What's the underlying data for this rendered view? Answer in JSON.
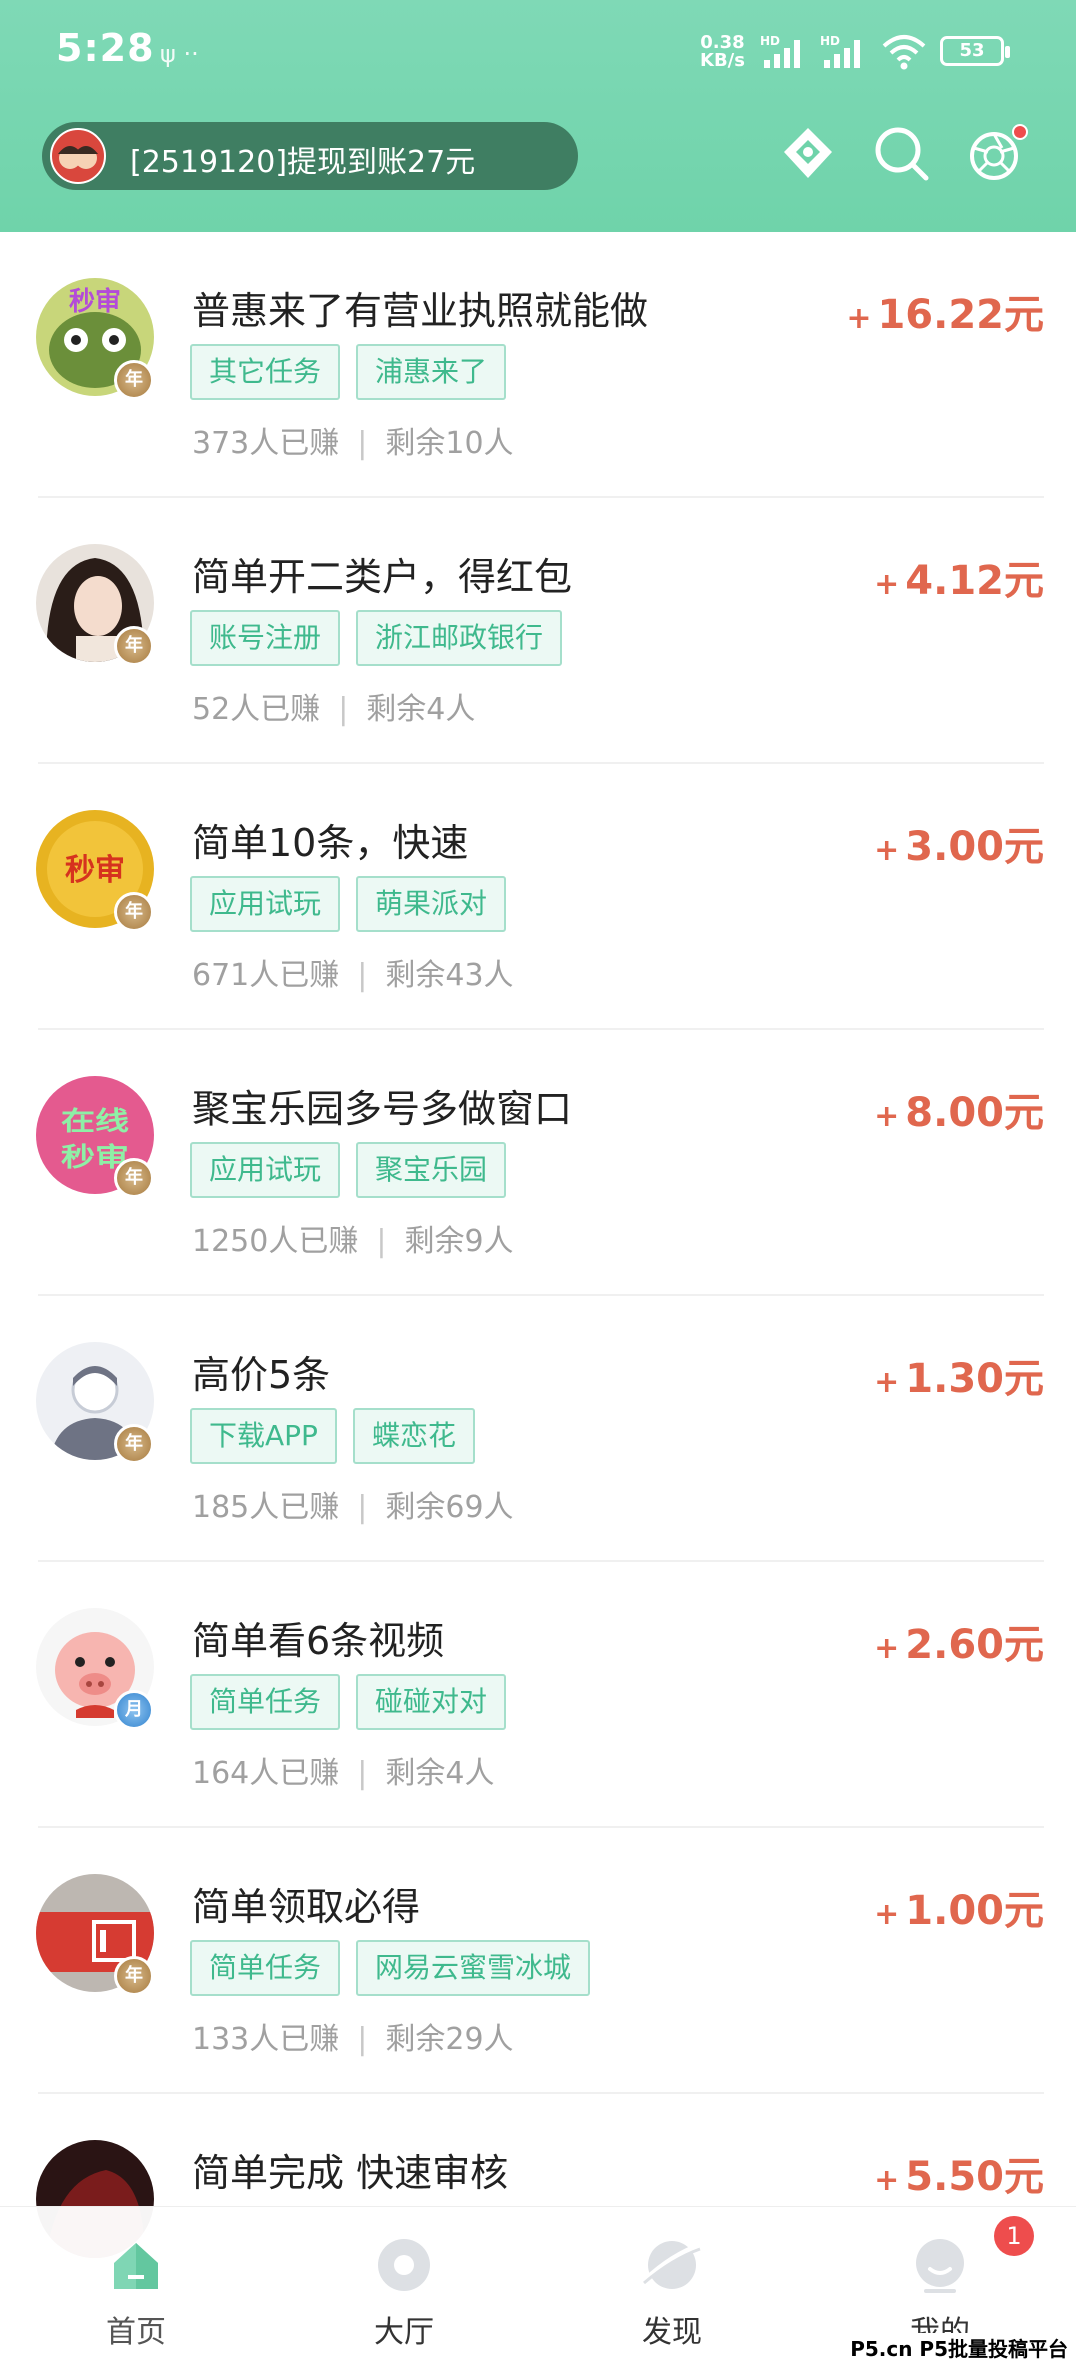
{
  "status_bar": {
    "time": "5:28",
    "extra_icons": "ψ  ··",
    "net_speed_value": "0.38",
    "net_speed_unit": "KB/s",
    "signal_label_1": "HD",
    "signal_label_2": "HD",
    "battery": "53"
  },
  "header": {
    "notice_text": "[2519120]提现到账27元",
    "icons": [
      "hall-logo-icon",
      "search-icon",
      "camera-shutter-icon"
    ]
  },
  "tasks": [
    {
      "title": "普惠来了有营业执照就能做",
      "reward": "16.22元",
      "tags": [
        "其它任务",
        "浦惠来了"
      ],
      "earned": "373人已赚",
      "remaining": "剩余10人",
      "badge": "年",
      "avatar_text": "秒审"
    },
    {
      "title": "简单开二类户，得红包",
      "reward": "4.12元",
      "tags": [
        "账号注册",
        "浙江邮政银行"
      ],
      "earned": "52人已赚",
      "remaining": "剩余4人",
      "badge": "年",
      "avatar_text": ""
    },
    {
      "title": "简单10条，快速",
      "reward": "3.00元",
      "tags": [
        "应用试玩",
        "萌果派对"
      ],
      "earned": "671人已赚",
      "remaining": "剩余43人",
      "badge": "年",
      "avatar_text": "秒审"
    },
    {
      "title": "聚宝乐园多号多做窗口",
      "reward": "8.00元",
      "tags": [
        "应用试玩",
        "聚宝乐园"
      ],
      "earned": "1250人已赚",
      "remaining": "剩余9人",
      "badge": "年",
      "avatar_text": "在线秒审"
    },
    {
      "title": "高价5条",
      "reward": "1.30元",
      "tags": [
        "下载APP",
        "蝶恋花"
      ],
      "earned": "185人已赚",
      "remaining": "剩余69人",
      "badge": "年",
      "avatar_text": ""
    },
    {
      "title": "简单看6条视频",
      "reward": "2.60元",
      "tags": [
        "简单任务",
        "碰碰对对"
      ],
      "earned": "164人已赚",
      "remaining": "剩余4人",
      "badge": "月",
      "avatar_text": ""
    },
    {
      "title": "简单领取必得",
      "reward": "1.00元",
      "tags": [
        "简单任务",
        "网易云蜜雪冰城"
      ],
      "earned": "133人已赚",
      "remaining": "剩余29人",
      "badge": "年",
      "avatar_text": ""
    },
    {
      "title": "简单完成 快速审核",
      "reward": "5.50元",
      "tags": [],
      "earned": "",
      "remaining": "",
      "badge": "",
      "avatar_text": ""
    }
  ],
  "reward_prefix": "+",
  "bottom_nav": [
    {
      "label": "首页",
      "icon": "home-icon",
      "active": true
    },
    {
      "label": "大厅",
      "icon": "hall-icon",
      "active": false
    },
    {
      "label": "发现",
      "icon": "discover-icon",
      "active": false
    },
    {
      "label": "我的",
      "icon": "profile-icon",
      "active": false
    }
  ],
  "profile_badge_count": "1",
  "watermark": "P5.cn P5批量投稿平台",
  "colors": {
    "header": "#6fd3aa",
    "reward": "#e0674e",
    "tag_text": "#3fb98d"
  }
}
